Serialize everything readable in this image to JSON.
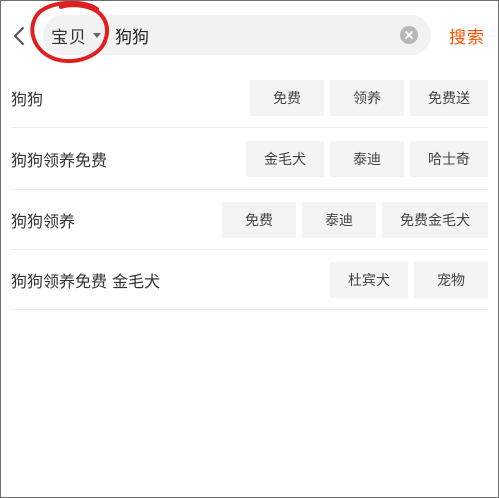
{
  "search": {
    "category": "宝贝",
    "query": "狗狗",
    "submit_label": "搜索"
  },
  "suggestions": [
    {
      "text": "狗狗",
      "tags": [
        "免费",
        "领养",
        "免费送"
      ]
    },
    {
      "text": "狗狗领养免费",
      "tags": [
        "金毛犬",
        "泰迪",
        "哈士奇"
      ]
    },
    {
      "text": "狗狗领养",
      "tags": [
        "免费",
        "泰迪",
        "免费金毛犬"
      ]
    },
    {
      "text": "狗狗领养免费 金毛犬",
      "tags": [
        "杜宾犬",
        "宠物"
      ]
    }
  ],
  "colors": {
    "accent": "#ff5000",
    "annotation": "#e02020",
    "chip_background": "#f4f4f4",
    "search_background": "#f2f2f2"
  },
  "icons": {
    "back": "chevron-left-icon",
    "dropdown": "caret-down-icon",
    "clear": "clear-circle-icon"
  }
}
